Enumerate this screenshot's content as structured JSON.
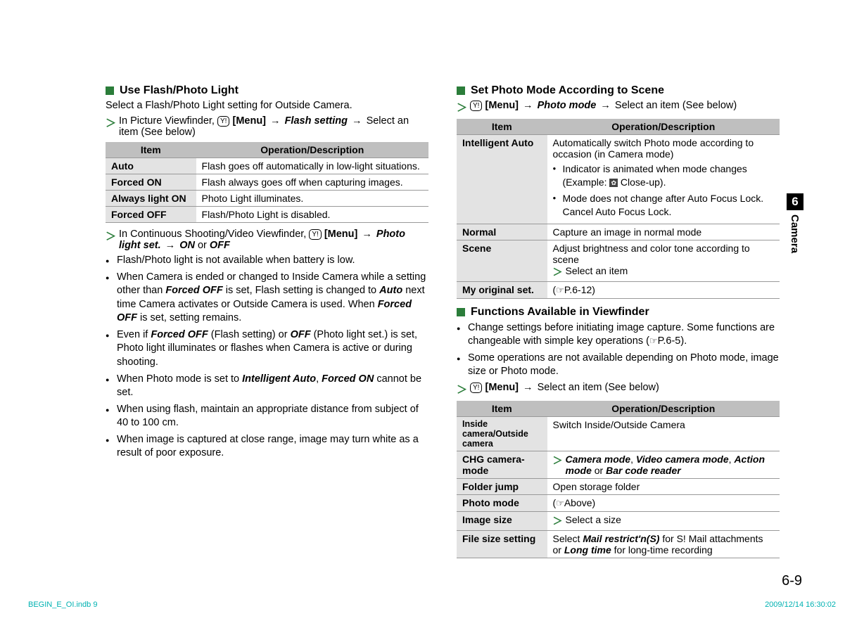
{
  "side_tab": {
    "num": "6",
    "label": "Camera"
  },
  "page_num": "6-9",
  "footer_left": "BEGIN_E_OI.indb   9",
  "footer_right": "2009/12/14   16:30:02",
  "left": {
    "title": "Use Flash/Photo Light",
    "sub": "Select a Flash/Photo Light setting for Outside Camera.",
    "step1_a": "In Picture Viewfinder, ",
    "step1_b": "[Menu]",
    "step1_c": "Flash setting",
    "step1_d": " Select an item (See below)",
    "table": {
      "h1": "Item",
      "h2": "Operation/Description",
      "r1a": "Auto",
      "r1b": "Flash goes off automatically in low-light situations.",
      "r2a": "Forced ON",
      "r2b": "Flash always goes off when capturing images.",
      "r3a": "Always light ON",
      "r3b": "Photo Light illuminates.",
      "r4a": "Forced OFF",
      "r4b": "Flash/Photo Light is disabled."
    },
    "step2_a": "In Continuous Shooting/Video Viewfinder, ",
    "step2_b": "[Menu]",
    "step2_c": "Photo light set.",
    "step2_d": "ON",
    "step2_e": " or ",
    "step2_f": "OFF",
    "b1": "Flash/Photo light is not available when battery is low.",
    "b2_a": "When Camera is ended or changed to Inside Camera while a setting other than ",
    "b2_b": "Forced OFF",
    "b2_c": " is set, Flash setting is changed to ",
    "b2_d": "Auto",
    "b2_e": " next time Camera activates or Outside Camera is used. When ",
    "b2_f": "Forced OFF",
    "b2_g": " is set, setting remains.",
    "b3_a": "Even if ",
    "b3_b": "Forced OFF",
    "b3_c": " (Flash setting) or ",
    "b3_d": "OFF",
    "b3_e": " (Photo light set.) is set, Photo light illuminates or flashes when Camera is active or during shooting.",
    "b4_a": "When Photo mode is set to ",
    "b4_b": "Intelligent Auto",
    "b4_c": ", ",
    "b4_d": "Forced ON",
    "b4_e": " cannot be set.",
    "b5": "When using flash, maintain an appropriate distance from subject of 40 to 100 cm.",
    "b6": "When image is captured at close range, image may turn white as a result of poor exposure."
  },
  "right": {
    "t1": "Set Photo Mode According to Scene",
    "s1_a": "[Menu]",
    "s1_b": "Photo mode",
    "s1_c": " Select an item (See below)",
    "table1": {
      "h1": "Item",
      "h2": "Operation/Description",
      "r1a": "Intelligent Auto",
      "r1b_top": "Automatically switch Photo mode according to occasion (in Camera mode)",
      "r1b_li1a": "Indicator is animated when mode changes (Example: ",
      "r1b_li1b": " Close-up).",
      "r1b_li2": "Mode does not change after Auto Focus Lock. Cancel Auto Focus Lock.",
      "r2a": "Normal",
      "r2b": "Capture an image in normal mode",
      "r3a": "Scene",
      "r3b_top": "Adjust brightness and color tone according to scene",
      "r3b_step": "Select an item",
      "r4a": "My original set.",
      "r4b_a": "(",
      "r4b_b": "P.6-12)"
    },
    "t2": "Functions Available in Viewfinder",
    "fb1_a": "Change settings before initiating image capture. Some functions are changeable with simple key operations (",
    "fb1_b": "P.6-5).",
    "fb2": "Some operations are not available depending on Photo mode, image size or Photo mode.",
    "s2_a": "[Menu]",
    "s2_b": " Select an item (See below)",
    "table2": {
      "h1": "Item",
      "h2": "Operation/Description",
      "r1a": "Inside camera/Outside camera",
      "r1b": "Switch Inside/Outside Camera",
      "r2a": "CHG camera-mode",
      "r2b_a": "Camera mode",
      "r2b_b": ", ",
      "r2b_c": "Video camera mode",
      "r2b_d": ", ",
      "r2b_e": "Action mode",
      "r2b_f": " or ",
      "r2b_g": "Bar code reader",
      "r3a": "Folder jump",
      "r3b": "Open storage folder",
      "r4a": "Photo mode",
      "r4b_a": "(",
      "r4b_b": "Above)",
      "r5a": "Image size",
      "r5b": "Select a size",
      "r6a": "File size setting",
      "r6b_a": "Select ",
      "r6b_b": "Mail restrict'n(S)",
      "r6b_c": " for S! Mail attachments or ",
      "r6b_d": "Long time",
      "r6b_e": " for long-time recording"
    }
  }
}
